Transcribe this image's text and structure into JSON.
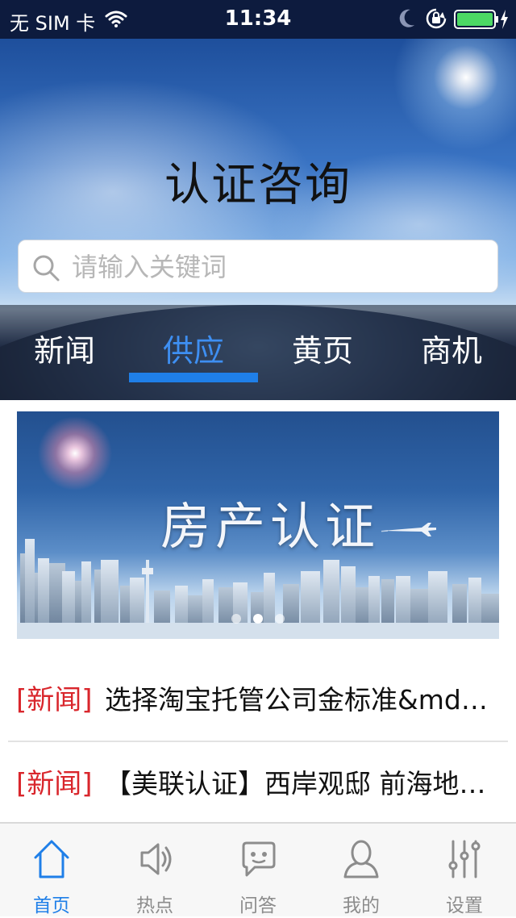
{
  "status_bar": {
    "carrier": "无 SIM 卡",
    "time": "11:34",
    "icons": [
      "wifi-icon",
      "moon-icon",
      "rotation-lock-icon",
      "battery-icon",
      "charging-bolt-icon"
    ],
    "battery_color": "#4cd964"
  },
  "header": {
    "title": "认证咨询",
    "search": {
      "placeholder": "请输入关键词",
      "icon": "search-icon"
    },
    "tabs": [
      {
        "label": "新闻",
        "active": false
      },
      {
        "label": "供应",
        "active": true
      },
      {
        "label": "黄页",
        "active": false
      },
      {
        "label": "商机",
        "active": false
      }
    ],
    "active_color": "#1f7fe8"
  },
  "banner": {
    "title": "房产认证",
    "slide_count": 3,
    "active_slide": 1
  },
  "news": [
    {
      "tag": "[新闻]",
      "title": "选择淘宝托管公司金标准&mdas…"
    },
    {
      "tag": "[新闻]",
      "title": "【美联认证】西岸观邸 前海地铁…"
    }
  ],
  "tab_bar": {
    "items": [
      {
        "label": "首页",
        "icon": "home-icon",
        "active": true
      },
      {
        "label": "热点",
        "icon": "speaker-icon",
        "active": false
      },
      {
        "label": "问答",
        "icon": "chat-bubble-icon",
        "active": false
      },
      {
        "label": "我的",
        "icon": "user-icon",
        "active": false
      },
      {
        "label": "设置",
        "icon": "sliders-icon",
        "active": false
      }
    ]
  },
  "colors": {
    "accent": "#1f7fe8",
    "news_tag": "#d9262c",
    "inactive_icon": "#8c8c8c"
  }
}
